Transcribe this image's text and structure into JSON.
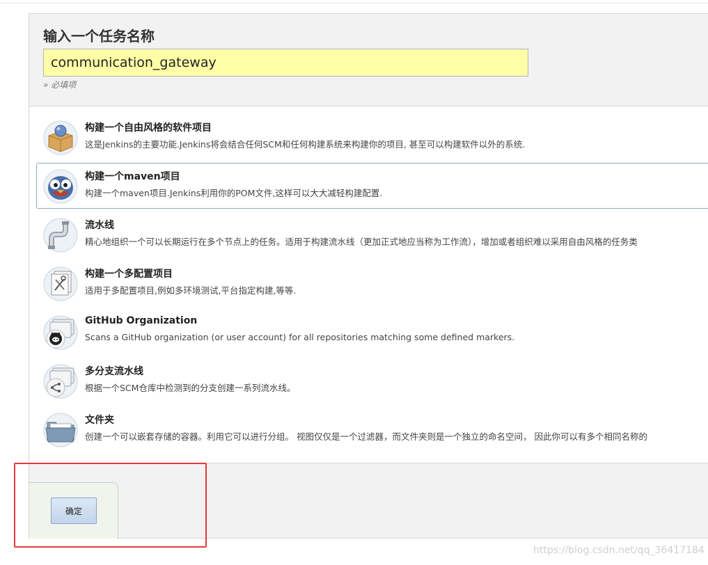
{
  "form": {
    "title": "输入一个任务名称",
    "item_name_value": "communication_gateway",
    "required_hint": "» 必填项"
  },
  "job_types": [
    {
      "title": "构建一个自由风格的软件项目",
      "description": "这是Jenkins的主要功能.Jenkins将会结合任何SCM和任何构建系统来构建你的项目, 甚至可以构建软件以外的系统.",
      "icon": "freestyle-project-icon",
      "selected": false
    },
    {
      "title": "构建一个maven项目",
      "description": "构建一个maven项目.Jenkins利用你的POM文件,这样可以大大减轻构建配置.",
      "icon": "maven-project-icon",
      "selected": true
    },
    {
      "title": "流水线",
      "description": "精心地组织一个可以长期运行在多个节点上的任务。适用于构建流水线（更加正式地应当称为工作流），增加或者组织难以采用自由风格的任务类",
      "icon": "pipeline-icon",
      "selected": false
    },
    {
      "title": "构建一个多配置项目",
      "description": "适用于多配置项目,例如多环境测试,平台指定构建,等等.",
      "icon": "multi-config-project-icon",
      "selected": false
    },
    {
      "title": "GitHub Organization",
      "description": "Scans a GitHub organization (or user account) for all repositories matching some defined markers.",
      "icon": "github-organization-icon",
      "selected": false
    },
    {
      "title": "多分支流水线",
      "description": "根据一个SCM仓库中检测到的分支创建一系列流水线。",
      "icon": "multibranch-pipeline-icon",
      "selected": false
    },
    {
      "title": "文件夹",
      "description": "创建一个可以嵌套存储的容器。利用它可以进行分组。 视图仅仅是一个过滤器，而文件夹则是一个独立的命名空间， 因此你可以有多个相同名称的",
      "icon": "folder-icon",
      "selected": false
    }
  ],
  "footer": {
    "ok_label": "确定"
  },
  "watermark": "https://blog.csdn.net/qq_36417184",
  "colors": {
    "input_background": "#ffffa8",
    "highlight_border": "#e53935",
    "selected_border": "#8fa9c8"
  }
}
